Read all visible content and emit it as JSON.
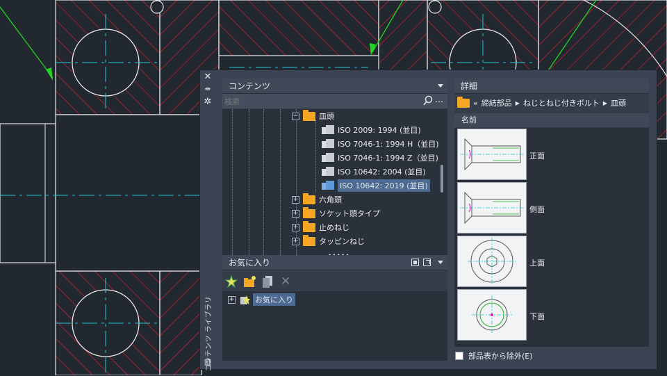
{
  "palette": {
    "title_vertical": "コンテンツ ライブラリ",
    "strip_icons": [
      "close-icon",
      "autohide-icon",
      "properties-icon",
      "library-icon"
    ]
  },
  "content": {
    "header": "コンテンツ",
    "search_placeholder": "検索",
    "more_label": "…",
    "tree": [
      {
        "label": "皿頭",
        "type": "folder",
        "expanded": true
      },
      {
        "label": "ISO 2009: 1994 (並目)",
        "type": "part"
      },
      {
        "label": "ISO 7046-1: 1994 H（並目)",
        "type": "part"
      },
      {
        "label": "ISO 7046-1: 1994 Z（並目)",
        "type": "part"
      },
      {
        "label": "ISO 10642: 2004 (並目)",
        "type": "part"
      },
      {
        "label": "ISO 10642: 2019 (並目)",
        "type": "part",
        "selected": true
      },
      {
        "label": "六角頭",
        "type": "folder"
      },
      {
        "label": "ソケット頭タイプ",
        "type": "folder"
      },
      {
        "label": "止めねじ",
        "type": "folder"
      },
      {
        "label": "タッピンねじ",
        "type": "folder"
      }
    ]
  },
  "favorites": {
    "header": "お気に入り",
    "item": "お気に入り"
  },
  "details": {
    "header": "詳細",
    "breadcrumb_back": "«",
    "breadcrumb": [
      "締結部品",
      "ねじとねじ付きボルト",
      "皿頭"
    ],
    "column_name": "名前",
    "views": [
      "正面",
      "側面",
      "上面",
      "下面"
    ]
  },
  "footer": {
    "checkbox_label": "部品表から除外(E)",
    "checked": false
  },
  "colors": {
    "accent": "#f5a623",
    "selection": "#4d6a93",
    "cad_hatch": "#d0202a",
    "cad_center": "#20c8d8",
    "cad_leader": "#22d422"
  }
}
